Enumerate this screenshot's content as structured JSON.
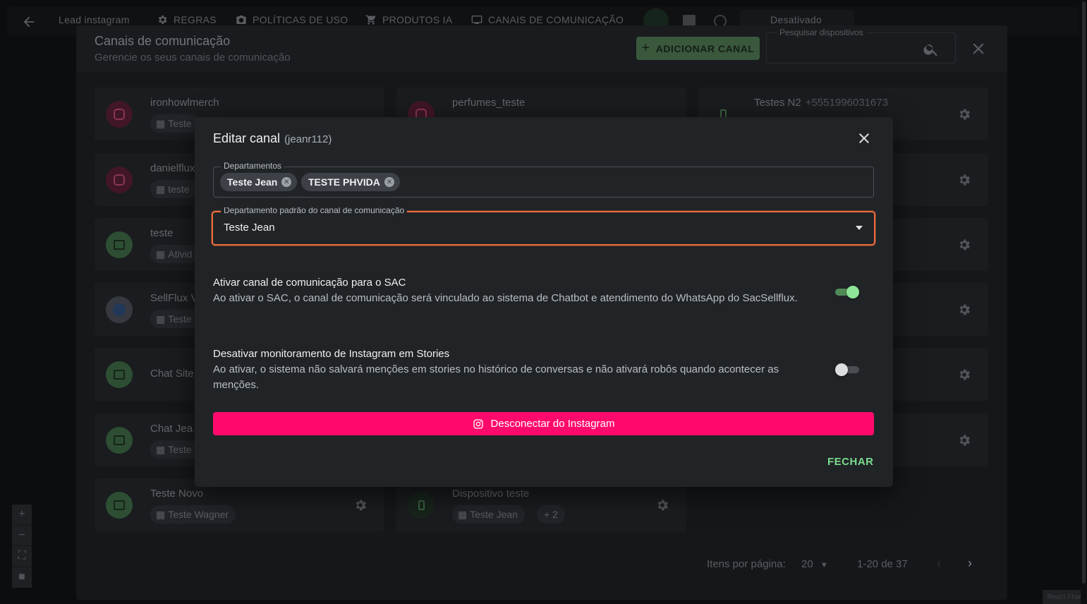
{
  "topbar": {
    "items": [
      "Lead instagram",
      "REGRAS",
      "POLÍTICAS DE USO",
      "PRODUTOS IA",
      "CANAIS DE COMUNICAÇÃO"
    ],
    "status": "Desativado"
  },
  "panel": {
    "title": "Canais de comunicação",
    "subtitle": "Gerencie os seus canais de comunicação",
    "add_button": "ADICIONAR CANAL",
    "search_label": "Pesquisar dispositivos"
  },
  "cards": [
    {
      "name": "ironhowlmerch",
      "chip": "Teste",
      "icon": "instagram-icon"
    },
    {
      "name": "perfumes_teste",
      "chip": "",
      "icon": "instagram-icon"
    },
    {
      "name": "Testes N2",
      "phone": "+5551996031673",
      "chip": "",
      "icon": "phone-icon"
    },
    {
      "name": "danielflux",
      "chip": "teste",
      "icon": "instagram-icon"
    },
    {
      "name": "teste",
      "chip": "Ativid",
      "icon": "chat-icon"
    },
    {
      "name": "SellFlux V",
      "chip": "Teste",
      "icon": "facebook-icon"
    },
    {
      "name": "Chat Site",
      "chip": "",
      "icon": "chat-icon"
    },
    {
      "name": "Chat Jea",
      "chip": "Teste",
      "icon": "chat-icon"
    },
    {
      "name": "Teste Novo",
      "chip": "Teste Wagner",
      "icon": "chat-icon"
    },
    {
      "name": "Dispositivo teste",
      "chip": "Teste Jean",
      "extra": "+ 2",
      "icon": "phone-icon"
    }
  ],
  "pagination": {
    "label": "Itens por página:",
    "per_page": "20",
    "range": "1-20 de 37"
  },
  "attribution": "React Flow",
  "dialog": {
    "title": "Editar canal",
    "subtitle": "(jeanr112)",
    "departments_label": "Departamentos",
    "departments": [
      "Teste Jean",
      "TESTE PHVIDA"
    ],
    "default_label": "Departamento padrão do canal de comunicação",
    "default_value": "Teste Jean",
    "sac_title": "Ativar canal de comunicação para o SAC",
    "sac_desc": "Ao ativar o SAC, o canal de comunicação será vinculado ao sistema de Chatbot e atendimento do WhatsApp do SacSellflux.",
    "sac_enabled": true,
    "stories_title": "Desativar monitoramento de Instagram em Stories",
    "stories_desc": "Ao ativar, o sistema não salvará menções em stories no histórico de conversas e não ativará robôs quando acontecer as menções.",
    "stories_enabled": false,
    "disconnect_button": "Desconectar do Instagram",
    "close_button": "FECHAR"
  },
  "colors": {
    "accent_green": "#7bdc8d",
    "instagram_pink": "#ff0a6c",
    "focus_orange": "#ee6b3e"
  }
}
